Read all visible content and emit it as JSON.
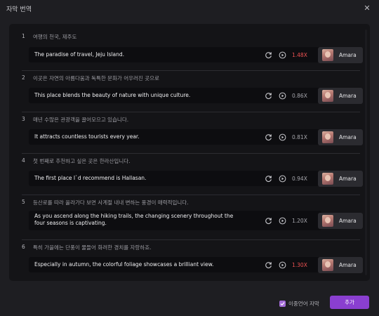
{
  "window": {
    "title": "자막 번역",
    "close_icon": "close-icon"
  },
  "rows": [
    {
      "num": "1",
      "source": "여행의 천국, 제주도",
      "text": "The paradise of travel, Jeju Island.",
      "speed": "1.48X",
      "speed_color": "#ee5252",
      "voice": "Amara"
    },
    {
      "num": "2",
      "source": "이곳은 자연의 아름다움과 독특한 문화가 어우러진 곳으로",
      "text": "This place blends the beauty of nature with unique culture.",
      "speed": "0.86X",
      "speed_color": "#a6a6ac",
      "voice": "Amara"
    },
    {
      "num": "3",
      "source": "매년 수많은 관광객을 끌어모으고 있습니다.",
      "text": "It attracts countless tourists every year.",
      "speed": "0.81X",
      "speed_color": "#a6a6ac",
      "voice": "Amara"
    },
    {
      "num": "4",
      "source": "첫 번째로 추천하고 싶은 곳은 한라산입니다.",
      "text": "The first place I`d recommend is Hallasan.",
      "speed": "0.94X",
      "speed_color": "#a6a6ac",
      "voice": "Amara"
    },
    {
      "num": "5",
      "source": "등산로를 따라 올라가다 보면 사계절 내내 변하는 풍경이 매력적입니다.",
      "text": "As you ascend along the hiking trails, the changing scenery throughout the four seasons is captivating.",
      "speed": "1.20X",
      "speed_color": "#a6a6ac",
      "voice": "Amara"
    },
    {
      "num": "6",
      "source": "특히 가을에는 단풍이 물들어 화려한 경치를 자랑하죠.",
      "text": "Especially in autumn, the colorful foliage showcases a brilliant view.",
      "speed": "1.30X",
      "speed_color": "#ee5252",
      "voice": "Amara"
    }
  ],
  "footer": {
    "checkbox_label": "이중언어 자막",
    "checkbox_checked": true,
    "add_label": "추가"
  },
  "colors": {
    "accent": "#8a3fd0",
    "warning": "#ee5252"
  }
}
